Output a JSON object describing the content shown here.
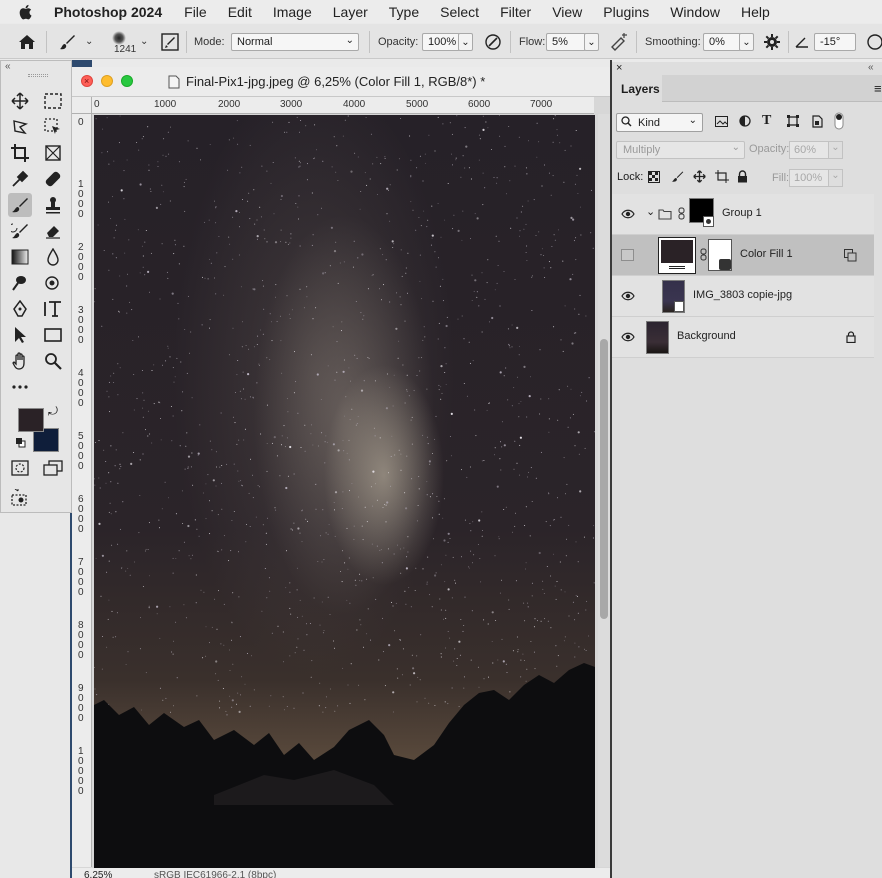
{
  "menubar": {
    "app": "Photoshop 2024",
    "items": [
      "File",
      "Edit",
      "Image",
      "Layer",
      "Type",
      "Select",
      "Filter",
      "View",
      "Plugins",
      "Window",
      "Help"
    ]
  },
  "options": {
    "brush_size": "1241",
    "mode_label": "Mode:",
    "mode_value": "Normal",
    "opacity_label": "Opacity:",
    "opacity_value": "100%",
    "flow_label": "Flow:",
    "flow_value": "5%",
    "smoothing_label": "Smoothing:",
    "smoothing_value": "0%",
    "angle_value": "-15°"
  },
  "document": {
    "title": "Final-Pix1-jpg.jpeg @ 6,25% (Color Fill 1, RGB/8*) *",
    "ruler_top": [
      "0",
      "1000",
      "2000",
      "3000",
      "4000",
      "5000",
      "6000",
      "7000"
    ],
    "ruler_left": [
      "0",
      "1000",
      "2000",
      "3000",
      "4000",
      "5000",
      "6000",
      "7000",
      "8000",
      "9000",
      "10000"
    ],
    "zoom": "6,25%",
    "profile": "sRGB IEC61966-2.1 (8bpc)"
  },
  "colors": {
    "foreground": "#2a2226",
    "background": "#0f1e3a"
  },
  "layers_panel": {
    "tab": "Layers",
    "filter_kind": "Kind",
    "blend_mode": "Multiply",
    "opacity_label": "Opacity:",
    "opacity_value": "60%",
    "lock_label": "Lock:",
    "fill_label": "Fill:",
    "fill_value": "100%",
    "layers": [
      {
        "name": "Group 1",
        "visible": true
      },
      {
        "name": "Color Fill 1",
        "visible": false
      },
      {
        "name": "IMG_3803 copie-jpg",
        "visible": true
      },
      {
        "name": "Background",
        "visible": true
      }
    ]
  }
}
